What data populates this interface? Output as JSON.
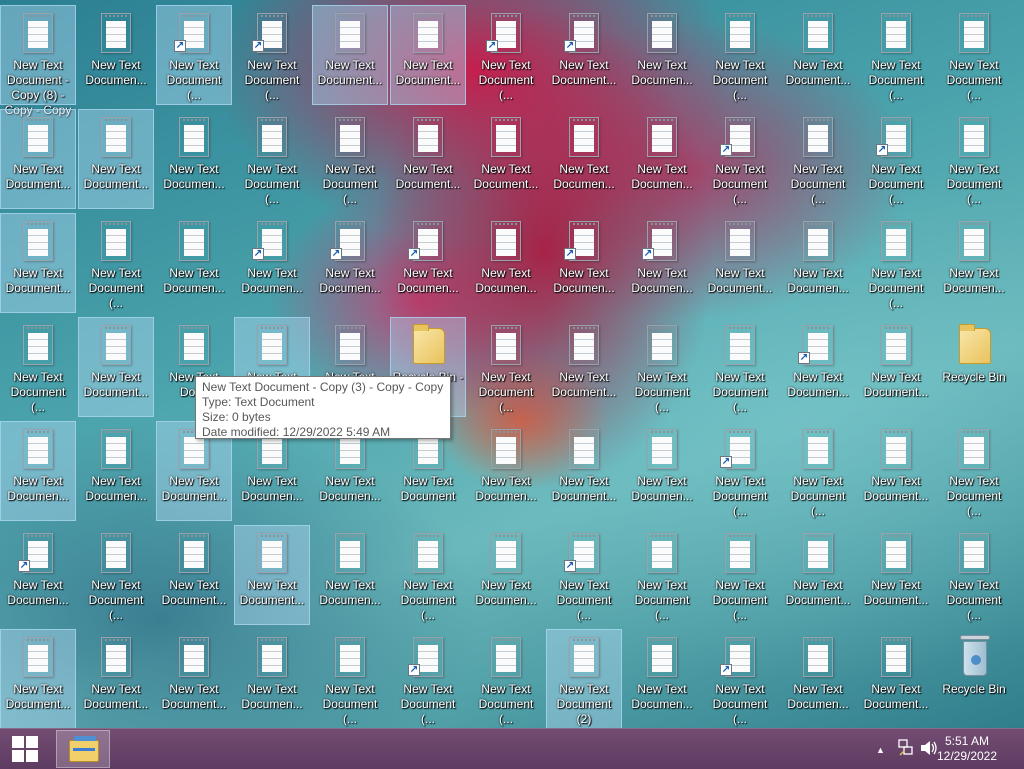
{
  "desktop": {
    "grid": [
      [
        {
          "label": "New Text Document - Copy (8) - Copy - Copy",
          "type": "doc",
          "selected": true
        },
        {
          "label": "New Text Documen...",
          "type": "doc"
        },
        {
          "label": "New Text Document (...",
          "type": "doc",
          "shortcut": true,
          "selected": true
        },
        {
          "label": "New Text Document (...",
          "type": "doc",
          "shortcut": true
        },
        {
          "label": "New Text Document...",
          "type": "doc",
          "selected": true
        },
        {
          "label": "New Text Document...",
          "type": "doc",
          "selected": true
        },
        {
          "label": "New Text Document (...",
          "type": "doc",
          "shortcut": true
        },
        {
          "label": "New Text Document...",
          "type": "doc",
          "shortcut": true
        },
        {
          "label": "New Text Documen...",
          "type": "doc"
        },
        {
          "label": "New Text Document (...",
          "type": "doc"
        },
        {
          "label": "New Text Document...",
          "type": "doc"
        },
        {
          "label": "New Text Document (...",
          "type": "doc"
        },
        {
          "label": "New Text Document (...",
          "type": "doc"
        }
      ],
      [
        {
          "label": "New Text Document...",
          "type": "doc",
          "selected": true
        },
        {
          "label": "New Text Document...",
          "type": "doc",
          "selected": true
        },
        {
          "label": "New Text Documen...",
          "type": "doc"
        },
        {
          "label": "New Text Document (...",
          "type": "doc"
        },
        {
          "label": "New Text Document (...",
          "type": "doc"
        },
        {
          "label": "New Text Document...",
          "type": "doc"
        },
        {
          "label": "New Text Document...",
          "type": "doc"
        },
        {
          "label": "New Text Documen...",
          "type": "doc"
        },
        {
          "label": "New Text Documen...",
          "type": "doc"
        },
        {
          "label": "New Text Document (...",
          "type": "doc",
          "shortcut": true
        },
        {
          "label": "New Text Document (...",
          "type": "doc"
        },
        {
          "label": "New Text Document (...",
          "type": "doc",
          "shortcut": true
        },
        {
          "label": "New Text Document (...",
          "type": "doc"
        }
      ],
      [
        {
          "label": "New Text Document...",
          "type": "doc",
          "selected": true
        },
        {
          "label": "New Text Document (...",
          "type": "doc"
        },
        {
          "label": "New Text Documen...",
          "type": "doc"
        },
        {
          "label": "New Text Documen...",
          "type": "doc",
          "shortcut": true
        },
        {
          "label": "New Text Documen...",
          "type": "doc",
          "shortcut": true
        },
        {
          "label": "New Text Documen...",
          "type": "doc",
          "shortcut": true
        },
        {
          "label": "New Text Documen...",
          "type": "doc"
        },
        {
          "label": "New Text Documen...",
          "type": "doc",
          "shortcut": true
        },
        {
          "label": "New Text Documen...",
          "type": "doc",
          "shortcut": true
        },
        {
          "label": "New Text Document...",
          "type": "doc"
        },
        {
          "label": "New Text Documen...",
          "type": "doc"
        },
        {
          "label": "New Text Document (...",
          "type": "doc"
        },
        {
          "label": "New Text Documen...",
          "type": "doc"
        }
      ],
      [
        {
          "label": "New Text Document (...",
          "type": "doc"
        },
        {
          "label": "New Text Document...",
          "type": "doc",
          "selected": true
        },
        {
          "label": "New Text Docu",
          "type": "doc"
        },
        {
          "label": "New Text Document - Copy (3) - Copy - Copy",
          "type": "doc",
          "selected": true
        },
        {
          "label": "New Text",
          "type": "doc"
        },
        {
          "label": "Recycle Bin -",
          "type": "folder",
          "selected": true
        },
        {
          "label": "New Text Document (...",
          "type": "doc"
        },
        {
          "label": "New Text Document...",
          "type": "doc"
        },
        {
          "label": "New Text Document (...",
          "type": "doc"
        },
        {
          "label": "New Text Document (...",
          "type": "doc"
        },
        {
          "label": "New Text Documen...",
          "type": "doc",
          "shortcut": true
        },
        {
          "label": "New Text Document...",
          "type": "doc"
        },
        {
          "label": "Recycle Bin",
          "type": "folder"
        }
      ],
      [
        {
          "label": "New Text Documen...",
          "type": "doc",
          "selected": true
        },
        {
          "label": "New Text Documen...",
          "type": "doc"
        },
        {
          "label": "New Text Document...",
          "type": "doc",
          "selected": true
        },
        {
          "label": "New Text Documen...",
          "type": "doc"
        },
        {
          "label": "New Text Documen...",
          "type": "doc"
        },
        {
          "label": "New Text Document",
          "type": "doc"
        },
        {
          "label": "New Text Documen...",
          "type": "doc"
        },
        {
          "label": "New Text Document...",
          "type": "doc"
        },
        {
          "label": "New Text Documen...",
          "type": "doc"
        },
        {
          "label": "New Text Document (...",
          "type": "doc",
          "shortcut": true
        },
        {
          "label": "New Text Document (...",
          "type": "doc"
        },
        {
          "label": "New Text Document...",
          "type": "doc"
        },
        {
          "label": "New Text Document (...",
          "type": "doc"
        }
      ],
      [
        {
          "label": "New Text Documen...",
          "type": "doc",
          "shortcut": true
        },
        {
          "label": "New Text Document (...",
          "type": "doc"
        },
        {
          "label": "New Text Document...",
          "type": "doc"
        },
        {
          "label": "New Text Document...",
          "type": "doc",
          "selected": true
        },
        {
          "label": "New Text Documen...",
          "type": "doc"
        },
        {
          "label": "New Text Document (...",
          "type": "doc"
        },
        {
          "label": "New Text Documen...",
          "type": "doc"
        },
        {
          "label": "New Text Document (...",
          "type": "doc",
          "shortcut": true
        },
        {
          "label": "New Text Document (...",
          "type": "doc"
        },
        {
          "label": "New Text Document (...",
          "type": "doc"
        },
        {
          "label": "New Text Document...",
          "type": "doc"
        },
        {
          "label": "New Text Document...",
          "type": "doc"
        },
        {
          "label": "New Text Document (...",
          "type": "doc"
        }
      ],
      [
        {
          "label": "New Text Document...",
          "type": "doc",
          "selected": true
        },
        {
          "label": "New Text Document...",
          "type": "doc"
        },
        {
          "label": "New Text Document...",
          "type": "doc"
        },
        {
          "label": "New Text Documen...",
          "type": "doc"
        },
        {
          "label": "New Text Document (...",
          "type": "doc"
        },
        {
          "label": "New Text Document (...",
          "type": "doc",
          "shortcut": true
        },
        {
          "label": "New Text Document (...",
          "type": "doc"
        },
        {
          "label": "New Text Document (2)",
          "type": "doc",
          "selected": true
        },
        {
          "label": "New Text Documen...",
          "type": "doc"
        },
        {
          "label": "New Text Document (...",
          "type": "doc",
          "shortcut": true
        },
        {
          "label": "New Text Documen...",
          "type": "doc"
        },
        {
          "label": "New Text Document...",
          "type": "doc"
        },
        {
          "label": "Recycle Bin",
          "type": "bin"
        }
      ]
    ]
  },
  "tooltip": {
    "name": "New Text Document - Copy (3) - Copy - Copy",
    "type": "Type: Text Document",
    "size": "Size: 0 bytes",
    "modified": "Date modified: 12/29/2022 5:49 AM"
  },
  "taskbar": {
    "start_icon": "windows-logo-icon",
    "pinned": [
      {
        "name": "file-explorer",
        "icon": "folder-icon"
      }
    ],
    "tray": {
      "show_hidden_glyph": "▲",
      "network_icon": "network-icon",
      "volume_icon": "speaker-icon",
      "time": "5:51 AM",
      "date": "12/29/2022"
    }
  },
  "colors": {
    "taskbar": "#6a3d6b",
    "selection": "#b4dcf5",
    "accent": "#3b82c4"
  }
}
